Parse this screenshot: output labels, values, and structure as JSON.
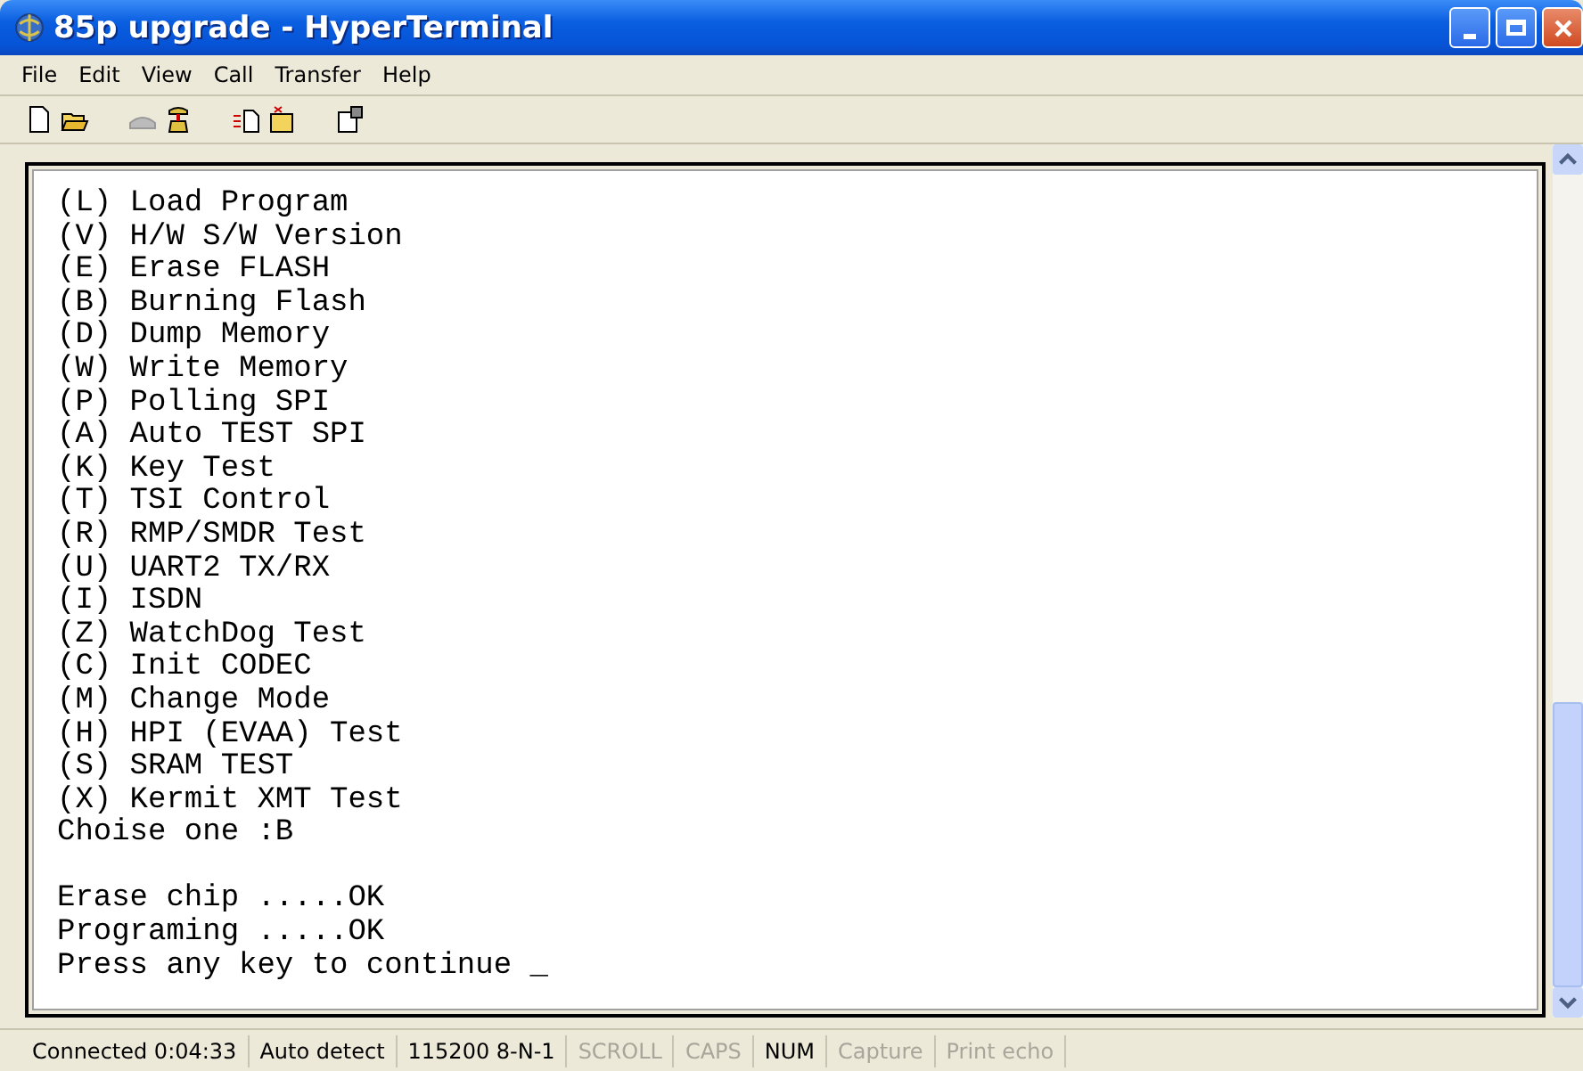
{
  "window": {
    "title": "85p upgrade - HyperTerminal"
  },
  "menu": [
    "File",
    "Edit",
    "View",
    "Call",
    "Transfer",
    "Help"
  ],
  "terminal": {
    "blocks": [
      [
        "(L) Load Program",
        "(V) H/W S/W Version",
        "(E) Erase FLASH",
        "(B) Burning Flash",
        "(D) Dump Memory",
        "(W) Write Memory",
        "(P) Polling SPI",
        "(A) Auto TEST SPI",
        "(K) Key Test",
        "(T) TSI Control",
        "(R) RMP/SMDR Test",
        "(U) UART2 TX/RX",
        "(I) ISDN",
        "(Z) WatchDog Test",
        "(C) Init CODEC",
        "(M) Change Mode",
        "(H) HPI (EVAA) Test",
        "(S) SRAM TEST",
        "(X) Kermit XMT Test",
        "Choise one :B"
      ],
      [
        "Erase chip .....OK",
        "Programing .....OK",
        "Press any key to continue _"
      ]
    ]
  },
  "status_bar": [
    {
      "text": "Connected 0:04:33",
      "on": true
    },
    {
      "text": "Auto detect",
      "on": true
    },
    {
      "text": "115200 8-N-1",
      "on": true
    },
    {
      "text": "SCROLL",
      "on": false
    },
    {
      "text": "CAPS",
      "on": false
    },
    {
      "text": "NUM",
      "on": true
    },
    {
      "text": "Capture",
      "on": false
    },
    {
      "text": "Print echo",
      "on": false
    }
  ]
}
